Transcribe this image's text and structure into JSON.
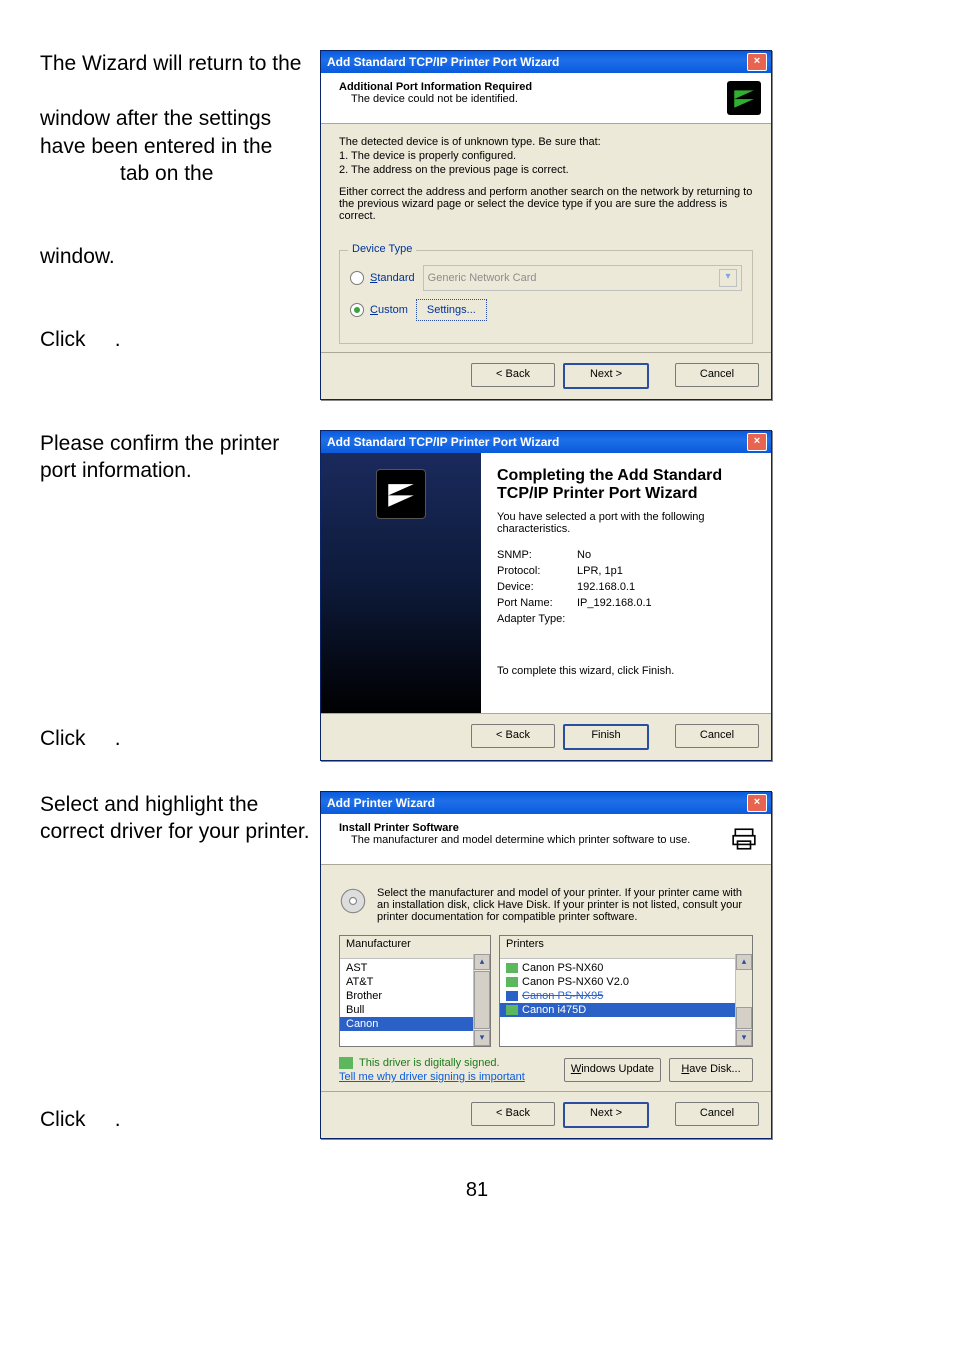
{
  "page_number": "81",
  "left_text": {
    "s1_l1": "The Wizard will return to the",
    "s1_l2": "window after the settings have been entered in the",
    "s1_l3": "tab on the",
    "s1_l4": "window.",
    "s1_l5": "Click",
    "s1_dot": ".",
    "s2_l1": "Please confirm the printer port information.",
    "s2_l2": "Click",
    "s3_l1": "Select and highlight the correct driver for your printer.",
    "s3_l2": "Click"
  },
  "dlg1": {
    "title": "Add Standard TCP/IP Printer Port Wizard",
    "band_title": "Additional Port Information Required",
    "band_sub": "The device could not be identified.",
    "p1": "The detected device is of unknown type.  Be sure that:",
    "p2": "1. The device is properly configured.",
    "p3": "2. The address on the previous page is correct.",
    "p4": "Either correct the address and perform another search on the network by returning to the previous wizard page or select the device type if you are sure the address is correct.",
    "gb_legend": "Device Type",
    "r_standard": "Standard",
    "dd_text": "Generic Network Card",
    "r_custom": "Custom",
    "settings": "Settings...",
    "back": "< Back",
    "next": "Next >",
    "cancel": "Cancel"
  },
  "dlg2": {
    "title": "Add Standard TCP/IP Printer Port Wizard",
    "ctitle": "Completing the Add Standard TCP/IP Printer Port Wizard",
    "cdesc": "You have selected a port with the following characteristics.",
    "snmp_k": "SNMP:",
    "snmp_v": "No",
    "proto_k": "Protocol:",
    "proto_v": "LPR, 1p1",
    "dev_k": "Device:",
    "dev_v": "192.168.0.1",
    "port_k": "Port Name:",
    "port_v": "IP_192.168.0.1",
    "adap_k": "Adapter Type:",
    "foot": "To complete this wizard, click Finish.",
    "back": "< Back",
    "finish": "Finish",
    "cancel": "Cancel"
  },
  "dlg3": {
    "title": "Add Printer Wizard",
    "band_title": "Install Printer Software",
    "band_sub": "The manufacturer and model determine which printer software to use.",
    "instr": "Select the manufacturer and model of your printer. If your printer came with an installation disk, click Have Disk. If your printer is not listed, consult your printer documentation for compatible printer software.",
    "mfr_header": "Manufacturer",
    "prn_header": "Printers",
    "mfr": [
      "AST",
      "AT&T",
      "Brother",
      "Bull",
      "Canon"
    ],
    "prn": [
      "Canon PS-NX60",
      "Canon PS-NX60 V2.0",
      "Canon i475D"
    ],
    "signed": "This driver is digitally signed.",
    "why": "Tell me why driver signing is important",
    "wupdate": "Windows Update",
    "havedisk": "Have Disk...",
    "back": "< Back",
    "next": "Next >",
    "cancel": "Cancel"
  }
}
